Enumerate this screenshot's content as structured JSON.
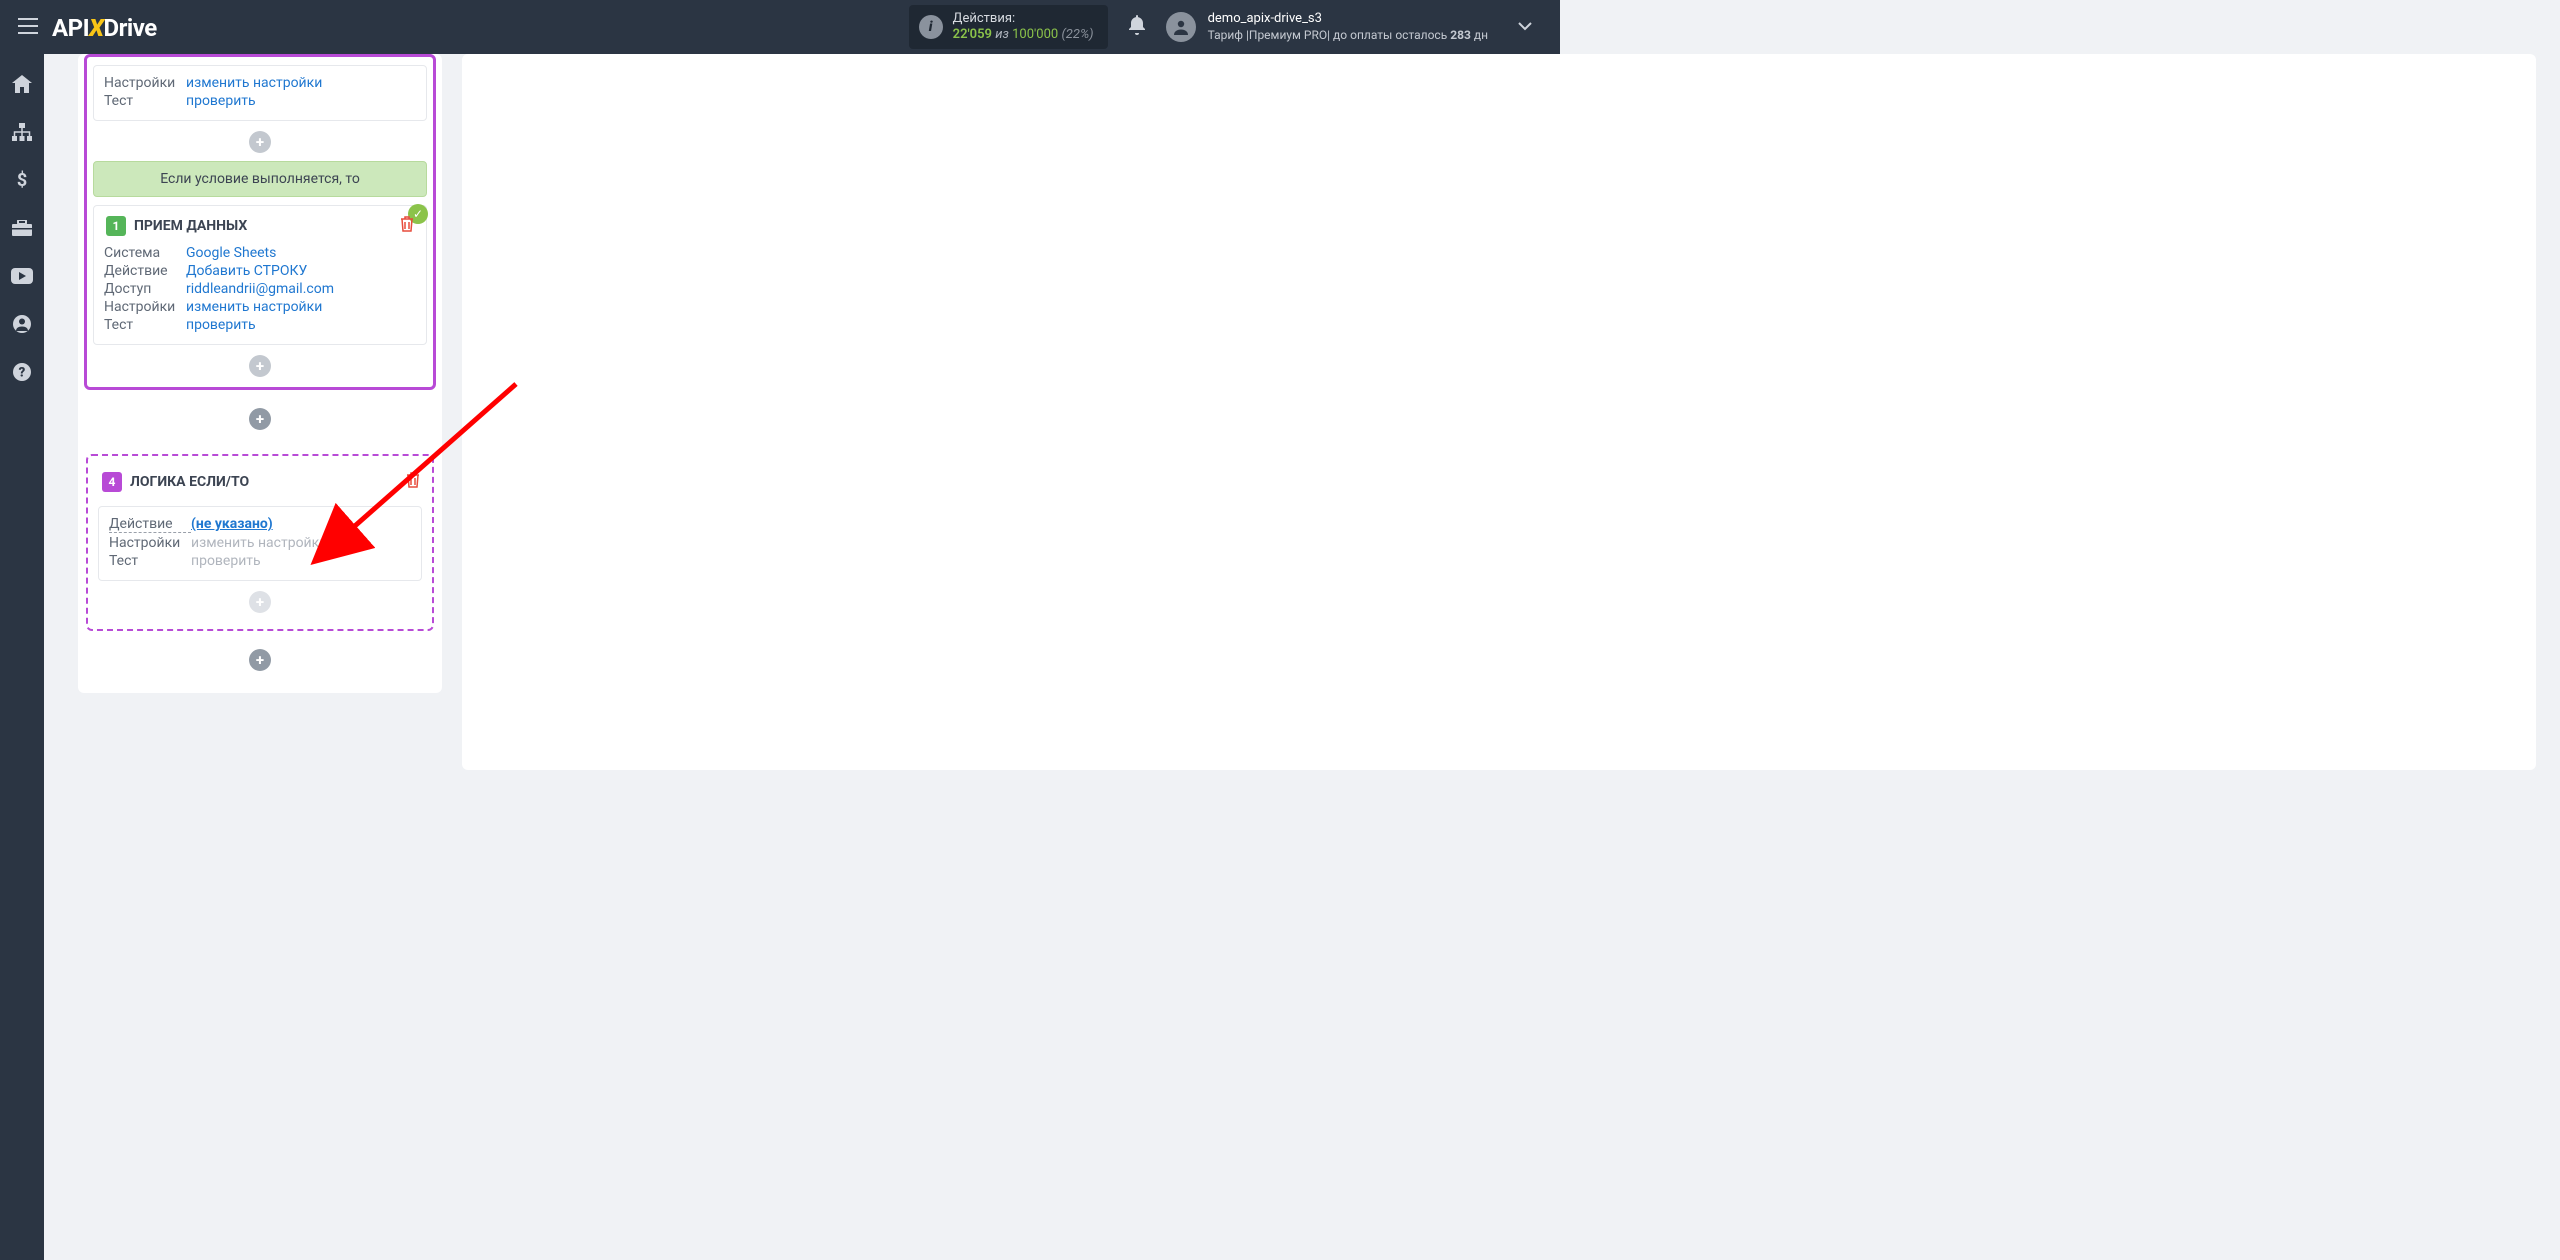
{
  "header": {
    "logo_pre": "API",
    "logo_x": "X",
    "logo_post": "Drive",
    "actions_label": "Действия:",
    "actions_used": "22'059",
    "actions_of": "из",
    "actions_total": "100'000",
    "actions_pct": "(22%)",
    "username": "demo_apix-drive_s3",
    "tariff_line_pre": "Тариф |Премиум PRO| до оплаты осталось ",
    "tariff_days": "283",
    "tariff_days_suffix": " дн"
  },
  "card_top": {
    "settings_label": "Настройки",
    "settings_value": "изменить настройки",
    "test_label": "Тест",
    "test_value": "проверить"
  },
  "condition_text": "Если условие выполняется, то",
  "card_receive": {
    "badge": "1",
    "title": "ПРИЕМ ДАННЫХ",
    "rows": [
      {
        "label": "Система",
        "value": "Google Sheets"
      },
      {
        "label": "Действие",
        "value": "Добавить СТРОКУ"
      },
      {
        "label": "Доступ",
        "value": "riddleandrii@gmail.com"
      },
      {
        "label": "Настройки",
        "value": "изменить настройки"
      },
      {
        "label": "Тест",
        "value": "проверить"
      }
    ]
  },
  "logic_block": {
    "badge": "4",
    "title": "ЛОГИКА ЕСЛИ/ТО",
    "action_label": "Действие",
    "action_value": "(не указано)",
    "settings_label": "Настройки",
    "settings_value": "изменить настройки",
    "test_label": "Тест",
    "test_value": "проверить"
  }
}
